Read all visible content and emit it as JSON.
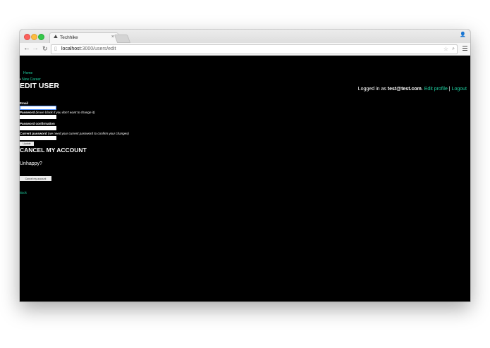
{
  "browser": {
    "tab_title": "Techhike",
    "tab_close": "×",
    "url_host": "localhost",
    "url_path": ":3000/users/edit"
  },
  "nav": {
    "home": "Home",
    "new_career_bullet": "•",
    "new_career": "New Career"
  },
  "page": {
    "title": "EDIT USER"
  },
  "account": {
    "prefix": "Logged in as",
    "email": "test@test.com",
    "period": ".",
    "edit_profile": "Edit profile",
    "separator": "|",
    "logout": "Logout"
  },
  "form": {
    "email_label": "Email",
    "email_value": "",
    "password_label": "Password",
    "password_hint": "(leave blank if you don't want to change it)",
    "password_confirmation_label": "Password confirmation",
    "current_password_label": "Current password",
    "current_password_hint": "(we need your current password to confirm your changes)",
    "update_button": "Update"
  },
  "cancel": {
    "title": "CANCEL MY ACCOUNT",
    "unhappy": "Unhappy?",
    "button": "Cancel my account"
  },
  "back_link": "Back",
  "colors": {
    "link": "#1dd1a1",
    "background": "#000000",
    "focus": "#4d90fe"
  }
}
